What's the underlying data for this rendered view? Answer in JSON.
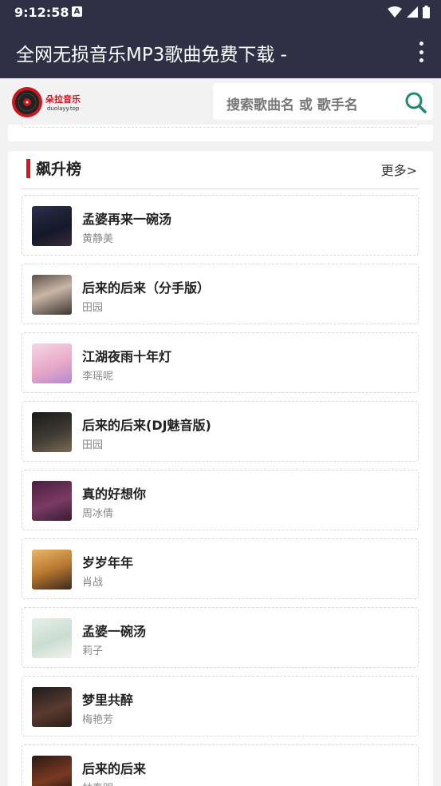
{
  "status_bar": {
    "time": "9:12:58",
    "notification_glyph": "A"
  },
  "app_bar": {
    "title": "全网无损音乐MP3歌曲免费下载 -"
  },
  "header": {
    "logo_text": "朵拉音乐",
    "logo_sub": "duolayy.top",
    "search_placeholder": "搜索歌曲名 或 歌手名"
  },
  "section": {
    "title": "飙升榜",
    "more": "更多>"
  },
  "songs": [
    {
      "title": "孟婆再来一碗汤",
      "artist": "黄静美"
    },
    {
      "title": "后来的后来（分手版）",
      "artist": "田园"
    },
    {
      "title": "江湖夜雨十年灯",
      "artist": "李瑶呢"
    },
    {
      "title": "后来的后来(DJ魅音版)",
      "artist": "田园"
    },
    {
      "title": "真的好想你",
      "artist": "周冰倩"
    },
    {
      "title": "岁岁年年",
      "artist": "肖战"
    },
    {
      "title": "孟婆一碗汤",
      "artist": "莉子"
    },
    {
      "title": "梦里共醉",
      "artist": "梅艳芳"
    },
    {
      "title": "后来的后来",
      "artist": "林春明"
    }
  ],
  "colors": {
    "app_bar": "#2f3046",
    "accent_red": "#e0121b",
    "search_icon": "#1f8a70"
  }
}
